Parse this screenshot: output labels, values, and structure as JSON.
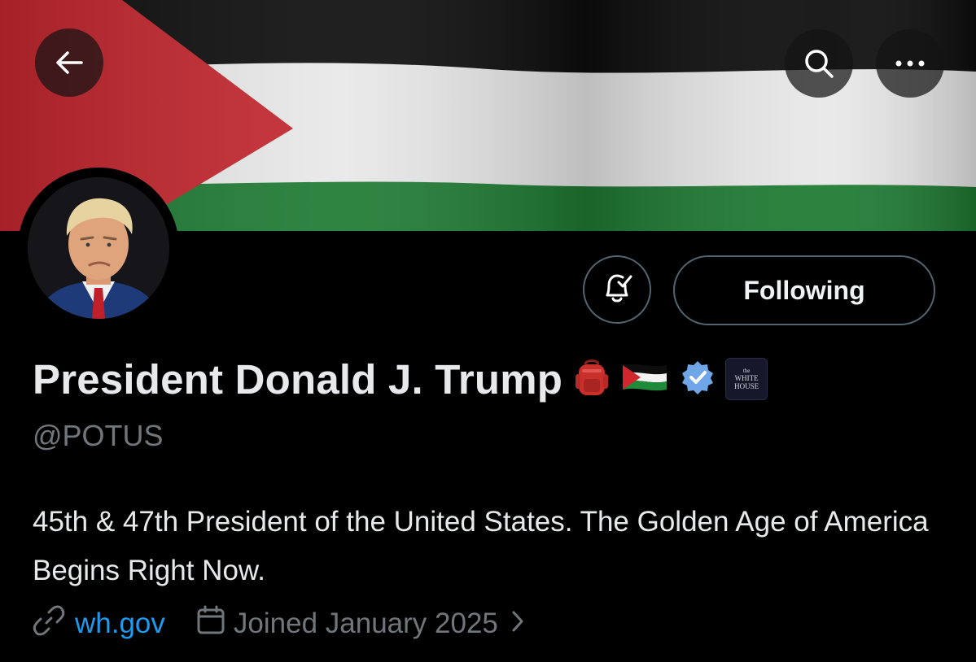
{
  "header": {
    "back_icon": "arrow-left-icon",
    "search_icon": "search-icon",
    "more_icon": "more-dots-icon"
  },
  "profile": {
    "display_name": "President Donald J. Trump",
    "handle": "@POTUS",
    "bio": "45th & 47th President of the United States. The Golden Age of America Begins Right Now.",
    "website": "wh.gov",
    "joined": "Joined January 2025",
    "verified_color": "#1d9bf0",
    "affiliation_badge": {
      "line1": "the",
      "line2": "WHITE",
      "line3": "HOUSE"
    }
  },
  "actions": {
    "notify_icon": "bell-check-icon",
    "following_label": "Following"
  },
  "colors": {
    "background": "#000000",
    "flag_red": "#c2262e",
    "flag_white": "#e8e8e8",
    "flag_green": "#1e7a32",
    "flag_black": "#0d0d0d",
    "link": "#1d9bf0",
    "muted": "#71767b"
  }
}
